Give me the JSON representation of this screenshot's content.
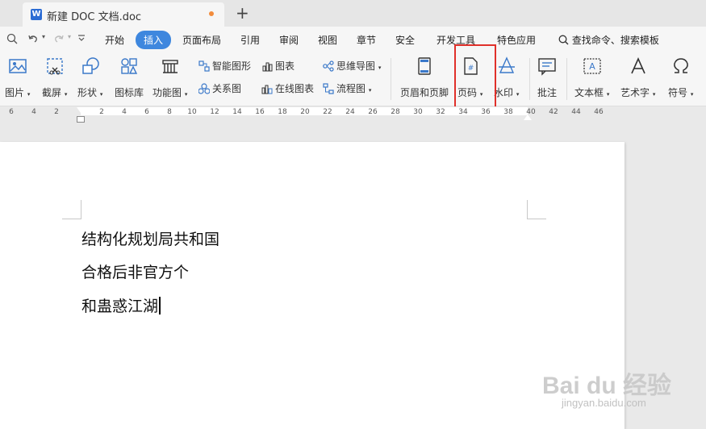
{
  "tab": {
    "title": "新建 DOC 文档.doc",
    "add_label": "+"
  },
  "menu": {
    "items": [
      "开始",
      "插入",
      "页面布局",
      "引用",
      "审阅",
      "视图",
      "章节",
      "安全",
      "开发工具",
      "特色应用"
    ],
    "active": "插入",
    "search": "查找命令、搜索模板"
  },
  "ribbon": {
    "picture": "图片",
    "screenshot": "截屏",
    "shape": "形状",
    "iconlib": "图标库",
    "funcmap": "功能图",
    "smartart": "智能图形",
    "relation": "关系图",
    "chart": "图表",
    "online_chart": "在线图表",
    "mindmap": "思维导图",
    "flowchart": "流程图",
    "header_footer": "页眉和页脚",
    "page_number": "页码",
    "watermark": "水印",
    "comment": "批注",
    "textbox": "文本框",
    "wordart": "艺术字",
    "symbol": "符号"
  },
  "ruler": {
    "left": [
      "6",
      "4",
      "2"
    ],
    "right": [
      "2",
      "4",
      "6",
      "8",
      "10",
      "12",
      "14",
      "16",
      "18",
      "20",
      "22",
      "24",
      "26",
      "28",
      "30",
      "32",
      "34",
      "36",
      "38",
      "40",
      "42",
      "44",
      "46"
    ]
  },
  "document": {
    "lines": [
      "结构化规划局共和国",
      "合格后非官方个",
      "和蛊惑江湖"
    ]
  },
  "watermark": {
    "brand": "Bai du 经验",
    "url": "jingyan.baidu.com"
  },
  "colors": {
    "accent": "#3e87de",
    "highlight": "#e0302a"
  }
}
